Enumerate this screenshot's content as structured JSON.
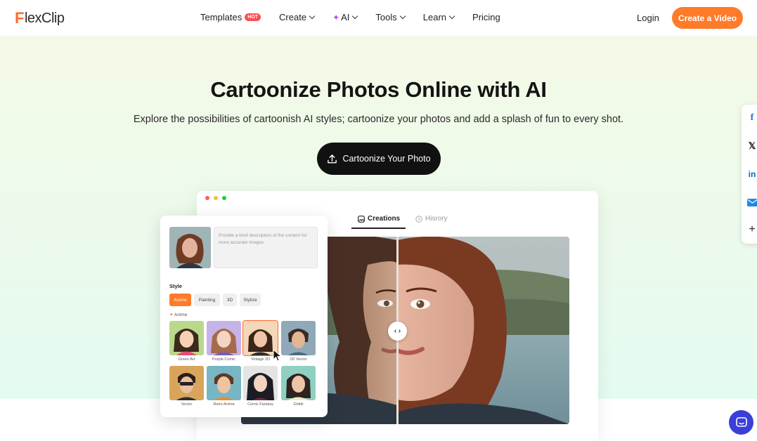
{
  "brand": {
    "logo_letter": "F",
    "logo_rest": "lexClip",
    "accent": "#ff7a29"
  },
  "nav": {
    "items": [
      {
        "label": "Templates",
        "badge": "HOT"
      },
      {
        "label": "Create"
      },
      {
        "label": "AI"
      },
      {
        "label": "Tools"
      },
      {
        "label": "Learn"
      },
      {
        "label": "Pricing"
      }
    ],
    "login": "Login",
    "cta": "Create a Video"
  },
  "hero": {
    "title": "Cartoonize Photos Online with AI",
    "subtitle": "Explore the possibilities of cartoonish AI styles; cartoonize your photos and add a splash of fun to every shot.",
    "cta": "Cartoonize Your Photo"
  },
  "window": {
    "tabs": [
      {
        "label": "Creations"
      },
      {
        "label": "Hisrory"
      }
    ]
  },
  "panel": {
    "description_placeholder": "Provide a brief description of the content for more accurate images",
    "style_label": "Style",
    "style_tabs": [
      "Anime",
      "Painting",
      "3D",
      "Stylize"
    ],
    "active_style": "Anime",
    "section_label": "Anime",
    "styles": [
      {
        "name": "Green Art"
      },
      {
        "name": "Purple Comic"
      },
      {
        "name": "Vintage 2D"
      },
      {
        "name": "2D Vector"
      },
      {
        "name": "Vector"
      },
      {
        "name": "Retro Anime"
      },
      {
        "name": "Comic Fantasy"
      },
      {
        "name": "Ghibli"
      }
    ],
    "selected_style": "Vintage 2D"
  },
  "social": {
    "icons": [
      "facebook-icon",
      "x-icon",
      "linkedin-icon",
      "email-icon",
      "plus-icon"
    ]
  }
}
